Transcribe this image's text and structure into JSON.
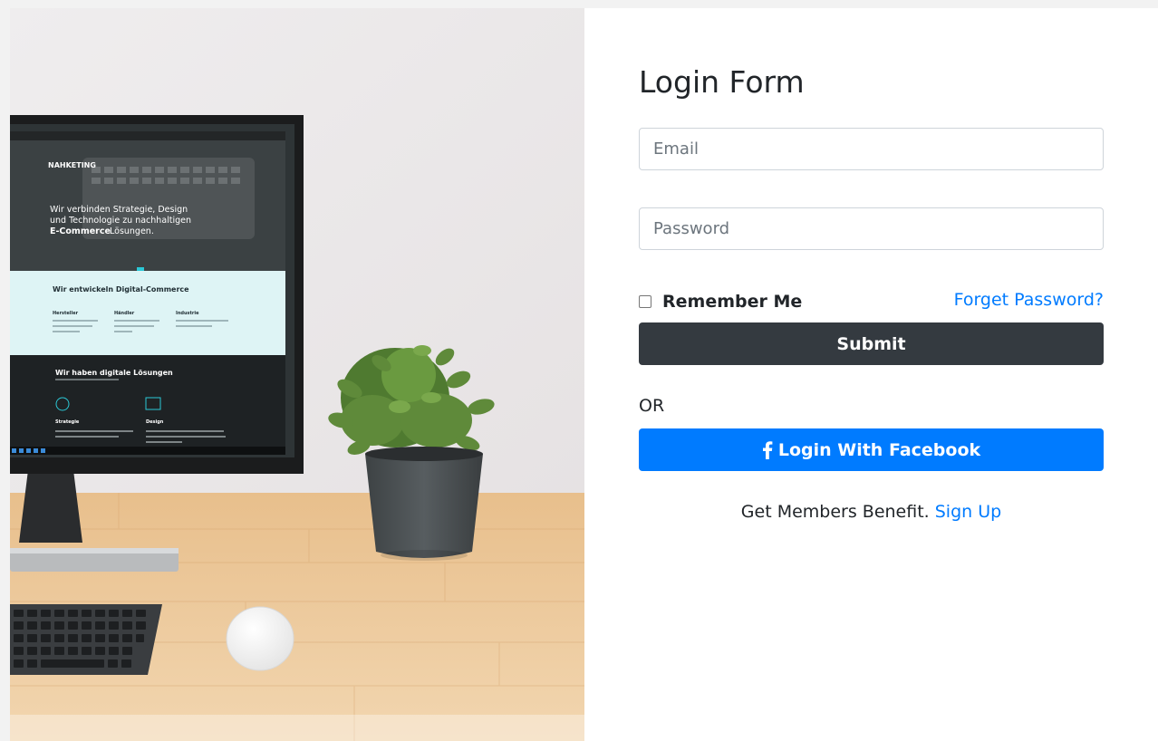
{
  "form": {
    "title": "Login Form",
    "email_placeholder": "Email",
    "password_placeholder": "Password",
    "remember_label": "Remember Me",
    "forget_label": "Forget Password?",
    "submit_label": "Submit",
    "or_label": "OR",
    "facebook_label": "Login With Facebook",
    "members_text": "Get Members Benefit.",
    "signup_label": "Sign Up"
  },
  "photo": {
    "brand": "NAHKETING",
    "hero_line1": "Wir verbinden Strategie, Design",
    "hero_line2": "und Technologie zu nachhaltigen",
    "hero_highlight": "E-Commerce",
    "hero_line3_rest": "Lösungen.",
    "section1_title": "Wir entwickeln Digital-Commerce",
    "col1": "Hersteller",
    "col2": "Händler",
    "col3": "Industrie",
    "section2_title": "Wir haben digitale Lösungen",
    "item1": "Strategie",
    "item2": "Design"
  },
  "colors": {
    "primary": "#007bff",
    "dark": "#343a40",
    "text": "#212529",
    "border": "#ced4da"
  }
}
